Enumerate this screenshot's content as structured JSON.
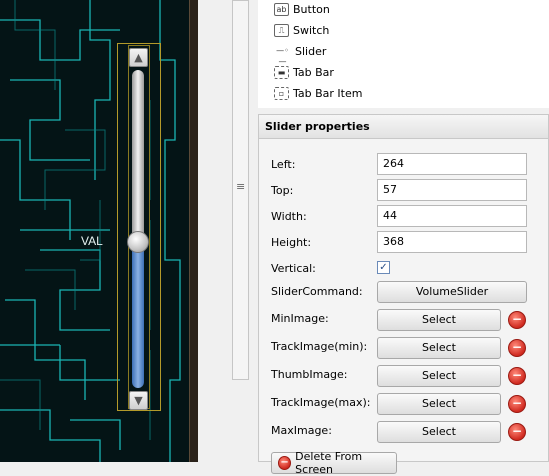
{
  "palette": {
    "items": [
      {
        "icon": "button-icon",
        "label": "Button"
      },
      {
        "icon": "switch-icon",
        "label": "Switch"
      },
      {
        "icon": "slider-icon",
        "label": "Slider"
      },
      {
        "icon": "tab-bar-icon",
        "label": "Tab Bar"
      },
      {
        "icon": "tab-bar-item-icon",
        "label": "Tab Bar Item"
      }
    ]
  },
  "canvas": {
    "slider_label": "VAL",
    "slider_level": 0.46
  },
  "props": {
    "title": "Slider properties",
    "left_label": "Left:",
    "left_value": "264",
    "top_label": "Top:",
    "top_value": "57",
    "width_label": "Width:",
    "width_value": "44",
    "height_label": "Height:",
    "height_value": "368",
    "vertical_label": "Vertical:",
    "vertical_checked": true,
    "command_label": "SliderCommand:",
    "command_value": "VolumeSlider",
    "min_image_label": "MinImage:",
    "track_min_label": "TrackImage(min):",
    "thumb_image_label": "ThumbImage:",
    "track_max_label": "TrackImage(max):",
    "max_image_label": "MaxImage:",
    "select_label": "Select",
    "delete_label": "Delete From Screen"
  },
  "colors": {
    "accent_track": "#5a8fd6",
    "delete_red": "#d02a20"
  }
}
